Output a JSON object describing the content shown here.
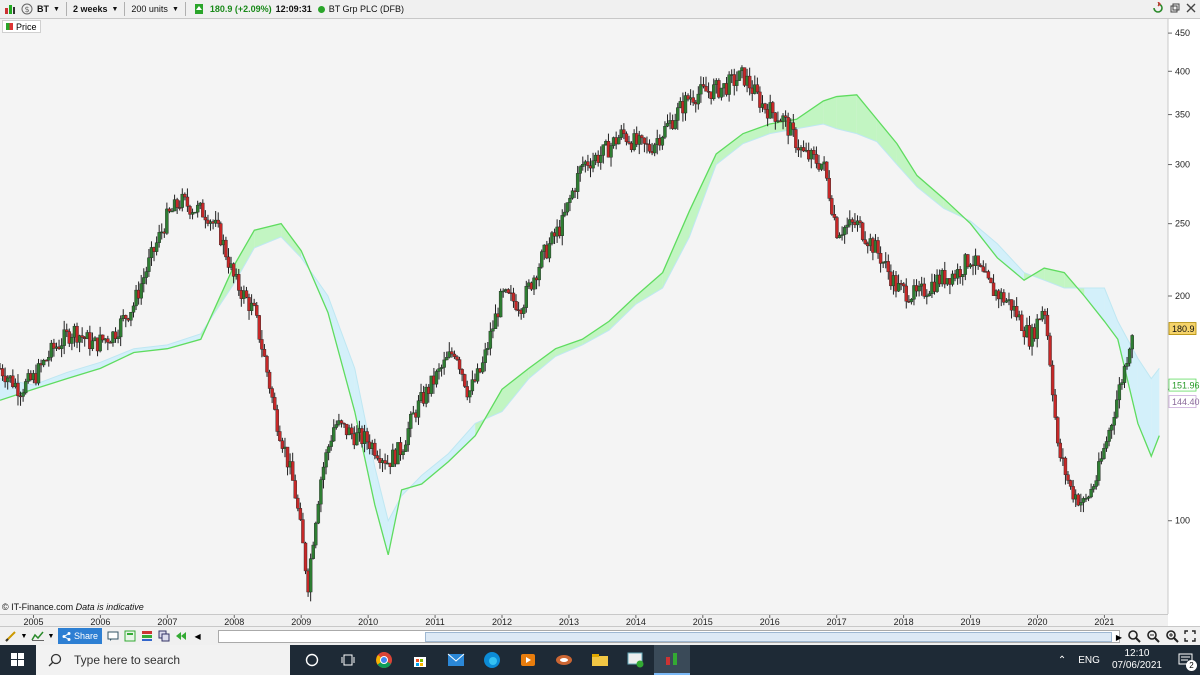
{
  "toolbar": {
    "symbol": "BT",
    "interval": "2 weeks",
    "units": "200 units",
    "price_change": "180.9 (+2.09%)",
    "time": "12:09:31",
    "instrument": "BT Grp PLC (DFB)"
  },
  "legend": {
    "label": "Price"
  },
  "credit": {
    "company": "© IT-Finance.com",
    "note": "Data is indicative"
  },
  "bottom": {
    "share_label": "Share"
  },
  "taskbar": {
    "search_placeholder": "Type here to search",
    "lang": "ENG",
    "clock_time": "12:10",
    "clock_date": "07/06/2021",
    "notif_count": "2"
  },
  "colors": {
    "up": "#2e7d32",
    "down": "#c62828",
    "cloud_green": "#b9f5b9",
    "cloud_blue": "#cdeefa",
    "span_line": "#5fdc5f",
    "price_tag": "#f5d36a"
  },
  "chart_data": {
    "type": "line",
    "title": "BT Grp PLC (DFB)",
    "ytype": "log",
    "ylim": [
      75,
      470
    ],
    "yticks": [
      100,
      150,
      200,
      250,
      300,
      350,
      400,
      450
    ],
    "ytick_labels": [
      "100",
      "",
      "200",
      "250",
      "300",
      "350",
      "400",
      "450"
    ],
    "x_years": [
      "2005",
      "2006",
      "2007",
      "2008",
      "2009",
      "2010",
      "2011",
      "2012",
      "2013",
      "2014",
      "2015",
      "2016",
      "2017",
      "2018",
      "2019",
      "2020",
      "2021"
    ],
    "xlim": [
      2004.5,
      2021.95
    ],
    "price_labels": {
      "last": "180.9",
      "span_a": "151.96",
      "span_b": "144.40"
    },
    "price_series": {
      "name": "Price",
      "x": [
        2004.5,
        2004.8,
        2005.0,
        2005.3,
        2005.6,
        2005.9,
        2006.2,
        2006.5,
        2006.8,
        2007.0,
        2007.2,
        2007.4,
        2007.6,
        2007.8,
        2008.0,
        2008.3,
        2008.6,
        2008.9,
        2009.1,
        2009.3,
        2009.5,
        2009.8,
        2010.0,
        2010.3,
        2010.5,
        2010.7,
        2010.9,
        2011.1,
        2011.3,
        2011.5,
        2011.7,
        2012.0,
        2012.3,
        2012.6,
        2012.9,
        2013.2,
        2013.5,
        2013.8,
        2014.0,
        2014.2,
        2014.5,
        2014.8,
        2015.0,
        2015.3,
        2015.6,
        2015.9,
        2016.2,
        2016.5,
        2016.8,
        2017.0,
        2017.3,
        2017.6,
        2017.9,
        2018.2,
        2018.5,
        2018.8,
        2019.0,
        2019.3,
        2019.6,
        2019.9,
        2020.1,
        2020.3,
        2020.5,
        2020.7,
        2020.9,
        2021.1,
        2021.3,
        2021.42
      ],
      "close": [
        160,
        150,
        155,
        170,
        180,
        172,
        178,
        195,
        230,
        255,
        268,
        262,
        258,
        240,
        210,
        190,
        140,
        110,
        82,
        115,
        135,
        130,
        128,
        120,
        125,
        140,
        150,
        160,
        170,
        148,
        160,
        200,
        195,
        225,
        250,
        300,
        310,
        330,
        320,
        315,
        340,
        370,
        375,
        380,
        395,
        360,
        345,
        310,
        300,
        245,
        250,
        230,
        205,
        200,
        210,
        215,
        225,
        205,
        195,
        175,
        195,
        125,
        110,
        105,
        115,
        135,
        160,
        180.9
      ]
    },
    "span_a_series": {
      "x": [
        2004.5,
        2005.0,
        2005.5,
        2006.0,
        2006.5,
        2007.0,
        2007.5,
        2008.0,
        2008.3,
        2008.7,
        2009.0,
        2009.4,
        2009.8,
        2010.1,
        2010.3,
        2010.5,
        2010.8,
        2011.2,
        2011.6,
        2012.0,
        2012.4,
        2012.8,
        2013.2,
        2013.6,
        2014.0,
        2014.4,
        2014.8,
        2015.2,
        2015.6,
        2016.0,
        2016.4,
        2016.8,
        2017.0,
        2017.3,
        2017.6,
        2017.9,
        2018.2,
        2018.6,
        2019.0,
        2019.4,
        2019.8,
        2020.1,
        2020.4,
        2020.7,
        2021.0,
        2021.2,
        2021.5,
        2021.7,
        2021.82
      ],
      "y": [
        145,
        150,
        155,
        160,
        168,
        170,
        175,
        220,
        245,
        250,
        230,
        190,
        140,
        105,
        90,
        110,
        112,
        120,
        130,
        150,
        160,
        170,
        175,
        185,
        200,
        215,
        260,
        310,
        330,
        340,
        345,
        365,
        370,
        372,
        345,
        320,
        290,
        270,
        250,
        225,
        210,
        218,
        215,
        200,
        185,
        175,
        135,
        122,
        130
      ]
    },
    "span_b_series": {
      "x": [
        2004.5,
        2005.0,
        2005.5,
        2006.0,
        2006.5,
        2007.0,
        2007.5,
        2008.0,
        2008.3,
        2008.7,
        2009.0,
        2009.4,
        2009.8,
        2010.1,
        2010.3,
        2010.5,
        2010.8,
        2011.2,
        2011.6,
        2012.0,
        2012.4,
        2012.8,
        2013.2,
        2013.6,
        2014.0,
        2014.4,
        2014.8,
        2015.2,
        2015.6,
        2016.0,
        2016.4,
        2016.8,
        2017.0,
        2017.3,
        2017.6,
        2017.9,
        2018.2,
        2018.6,
        2019.0,
        2019.4,
        2019.8,
        2020.1,
        2020.4,
        2020.7,
        2021.0,
        2021.2,
        2021.5,
        2021.7,
        2021.82
      ],
      "y": [
        155,
        152,
        158,
        163,
        170,
        172,
        178,
        208,
        232,
        240,
        225,
        200,
        160,
        118,
        100,
        108,
        115,
        123,
        135,
        140,
        155,
        166,
        172,
        180,
        195,
        205,
        240,
        300,
        320,
        330,
        335,
        340,
        335,
        330,
        322,
        300,
        280,
        262,
        252,
        235,
        215,
        210,
        205,
        205,
        205,
        185,
        165,
        155,
        160
      ]
    }
  }
}
